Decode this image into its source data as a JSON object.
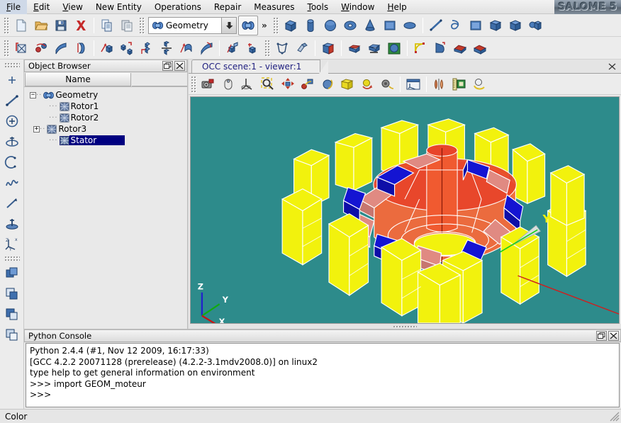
{
  "app": {
    "logo_text": "SALOME 5",
    "status_text": "Color"
  },
  "menubar": {
    "items": [
      {
        "label": "File",
        "mnemonic": "F"
      },
      {
        "label": "Edit",
        "mnemonic": "E"
      },
      {
        "label": "View",
        "mnemonic": "V"
      },
      {
        "label": "New Entity",
        "mnemonic": ""
      },
      {
        "label": "Operations",
        "mnemonic": ""
      },
      {
        "label": "Repair",
        "mnemonic": ""
      },
      {
        "label": "Measures",
        "mnemonic": ""
      },
      {
        "label": "Tools",
        "mnemonic": "T"
      },
      {
        "label": "Window",
        "mnemonic": "W"
      },
      {
        "label": "Help",
        "mnemonic": "H"
      }
    ]
  },
  "toolbar_main": {
    "module_combo": {
      "value": "Geometry",
      "icon": "geometry-module-icon",
      "arrow_icon": "chevron-down-icon"
    },
    "overflow_label": "»",
    "buttons": [
      {
        "name": "new-document-button",
        "icon": "new-document-icon",
        "tooltip": "New"
      },
      {
        "name": "open-document-button",
        "icon": "open-folder-icon",
        "tooltip": "Open"
      },
      {
        "name": "save-document-button",
        "icon": "save-floppy-icon",
        "tooltip": "Save"
      },
      {
        "name": "delete-button",
        "icon": "delete-x-icon",
        "tooltip": "Delete"
      },
      {
        "name": "copy-button",
        "icon": "copy-icon",
        "tooltip": "Copy"
      },
      {
        "name": "paste-button",
        "icon": "paste-icon",
        "tooltip": "Paste"
      },
      {
        "name": "module-activate-button",
        "icon": "geometry-module-icon",
        "tooltip": "Geometry"
      }
    ],
    "primitives": [
      {
        "name": "create-box-button",
        "icon": "box-icon"
      },
      {
        "name": "create-cylinder-button",
        "icon": "cylinder-icon"
      },
      {
        "name": "create-sphere-button",
        "icon": "sphere-icon"
      },
      {
        "name": "create-torus-button",
        "icon": "torus-icon"
      },
      {
        "name": "create-cone-button",
        "icon": "cone-icon"
      },
      {
        "name": "create-face-button",
        "icon": "face-icon"
      },
      {
        "name": "create-disk-button",
        "icon": "disk-icon"
      }
    ],
    "builders": [
      {
        "name": "build-edge-button",
        "icon": "edge-icon"
      },
      {
        "name": "build-wire-button",
        "icon": "wire-icon"
      },
      {
        "name": "build-face-button",
        "icon": "build-face-icon"
      },
      {
        "name": "build-shell-button",
        "icon": "shell-icon"
      },
      {
        "name": "build-solid-button",
        "icon": "solid-icon"
      },
      {
        "name": "build-compound-button",
        "icon": "compound-icon"
      }
    ]
  },
  "toolbar_second": {
    "transform": [
      {
        "name": "scale-transform-button",
        "icon": "scale-icon"
      },
      {
        "name": "mirror-button",
        "icon": "mirror-icon"
      },
      {
        "name": "offset-button",
        "icon": "offset-icon"
      },
      {
        "name": "projection-button",
        "icon": "projection-icon"
      }
    ],
    "boolean_ops": [
      {
        "name": "translate-button",
        "icon": "translate-icon"
      },
      {
        "name": "rotate-button",
        "icon": "rotate-icon"
      },
      {
        "name": "position-button",
        "icon": "position-icon"
      },
      {
        "name": "multi-translate-button",
        "icon": "multi-translate-icon"
      },
      {
        "name": "extrusion-button",
        "icon": "extrusion-icon"
      },
      {
        "name": "revolution-button",
        "icon": "revolution-icon"
      }
    ],
    "group_ops": [
      {
        "name": "partition-button",
        "icon": "partition-icon"
      },
      {
        "name": "archimede-button",
        "icon": "archimede-icon"
      }
    ],
    "repair_ops": [
      {
        "name": "shape-process-button",
        "icon": "shape-process-icon"
      },
      {
        "name": "suppress-faces-button",
        "icon": "suppress-faces-icon"
      },
      {
        "name": "explode-button",
        "icon": "explode-icon"
      },
      {
        "name": "glue-faces-button",
        "icon": "glue-faces-icon"
      },
      {
        "name": "check-shape-button",
        "icon": "check-shape-icon"
      },
      {
        "name": "fuse-button",
        "icon": "fuse-icon"
      },
      {
        "name": "common-button",
        "icon": "common-icon"
      },
      {
        "name": "cut-button",
        "icon": "cut-icon"
      },
      {
        "name": "section-button",
        "icon": "section-icon"
      }
    ]
  },
  "toolbar_left": {
    "basic": [
      {
        "name": "create-point-button",
        "icon": "point-icon"
      },
      {
        "name": "create-line-button",
        "icon": "line-icon"
      },
      {
        "name": "create-circle-button",
        "icon": "circle-icon"
      },
      {
        "name": "create-ellipse-button",
        "icon": "ellipse-icon"
      },
      {
        "name": "create-arc-button",
        "icon": "arc-icon"
      },
      {
        "name": "create-curve-button",
        "icon": "curve-icon"
      },
      {
        "name": "create-vector-button",
        "icon": "vector-icon"
      },
      {
        "name": "create-plane-button",
        "icon": "plane-icon"
      },
      {
        "name": "create-lcs-button",
        "icon": "local-cs-icon"
      }
    ],
    "groups": [
      {
        "name": "create-group-button",
        "icon": "group-icon"
      },
      {
        "name": "edit-group-button",
        "icon": "edit-group-icon"
      },
      {
        "name": "create-field-button",
        "icon": "field-icon"
      },
      {
        "name": "edit-field-button",
        "icon": "edit-field-icon"
      }
    ]
  },
  "object_browser": {
    "title": "Object Browser",
    "column_header": "Name",
    "undock_icon": "undock-icon",
    "close_icon": "close-icon",
    "tree": [
      {
        "label": "Geometry",
        "level": 0,
        "expander": "−",
        "selected": false,
        "icon": "geometry-module-icon"
      },
      {
        "label": "Rotor1",
        "level": 1,
        "expander": "",
        "selected": false,
        "icon": "shape-icon"
      },
      {
        "label": "Rotor2",
        "level": 1,
        "expander": "",
        "selected": false,
        "icon": "shape-icon"
      },
      {
        "label": "Rotor3",
        "level": 1,
        "expander": "+",
        "selected": false,
        "icon": "shape-icon"
      },
      {
        "label": "Stator",
        "level": 1,
        "expander": "",
        "selected": true,
        "icon": "shape-icon"
      }
    ]
  },
  "viewer": {
    "tab_label": "OCC scene:1 - viewer:1",
    "close_icon": "close-icon",
    "undock_icon": "undock-icon",
    "background_color": "#2d8b8b",
    "toolbar": [
      {
        "name": "dump-view-button",
        "icon": "camera-icon"
      },
      {
        "name": "mouse-style-button",
        "icon": "mouse-icon"
      },
      {
        "name": "show-trihedron-button",
        "icon": "trihedron-icon"
      },
      {
        "name": "zoom-button",
        "icon": "magnifier-icon"
      },
      {
        "name": "pan-button",
        "icon": "pan-arrows-icon"
      },
      {
        "name": "glob-pan-button",
        "icon": "global-pan-icon"
      },
      {
        "name": "rotate-view-button",
        "icon": "rotate-view-icon"
      },
      {
        "name": "fit-all-button",
        "icon": "fit-all-cube-icon"
      },
      {
        "name": "rotation-point-button",
        "icon": "rotation-point-icon"
      },
      {
        "name": "clone-view-button",
        "icon": "clone-view-icon"
      },
      {
        "name": "scene-window-button",
        "icon": "scene-window-icon"
      },
      {
        "name": "shading-mode-button",
        "icon": "shading-icon"
      },
      {
        "name": "measure-button",
        "icon": "ruler-icon"
      },
      {
        "name": "display-mode-button",
        "icon": "display-mode-icon"
      }
    ],
    "axes": {
      "z_label": "Z",
      "y_label": "Y",
      "x_label": "X",
      "z_color": "#2222cc",
      "y_color": "#11aa11",
      "x_color": "#cc1111",
      "viewport_y_label": "Y"
    },
    "model": {
      "name": "electric-motor-assembly",
      "stator_color": "#f2f20d",
      "magnet_blue_color": "#1414d2",
      "magnet_pink_color": "#e08a82",
      "rotor_core_color": "#f26a3c",
      "rotor_top_color": "#e8442a",
      "edge_color": "#ffffff"
    }
  },
  "python_console": {
    "title": "Python Console",
    "undock_icon": "undock-icon",
    "close_icon": "close-icon",
    "lines": [
      "Python 2.4.4 (#1, Nov 12 2009, 16:17:33)",
      "[GCC 4.2.2 20071128 (prerelease) (4.2.2-3.1mdv2008.0)] on linux2",
      "type help to get general information on environment",
      ">>> import GEOM_moteur",
      ">>> "
    ]
  }
}
